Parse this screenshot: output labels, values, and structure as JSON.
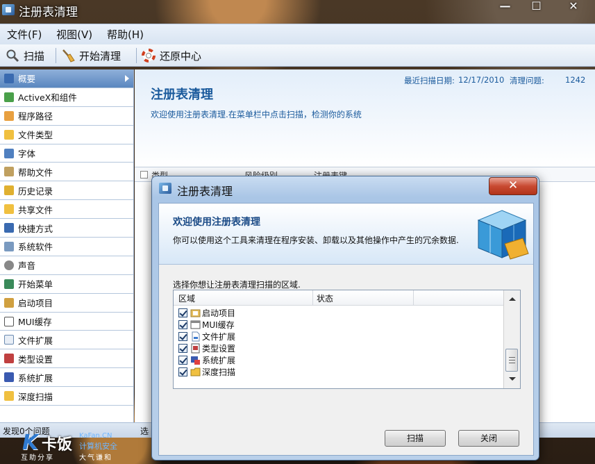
{
  "window": {
    "title": "注册表清理",
    "minimize": "—",
    "maximize": "☐",
    "close": "✕"
  },
  "menu": [
    "文件(F)",
    "视图(V)",
    "帮助(H)"
  ],
  "toolbar": {
    "scan": "扫描",
    "clean": "开始清理",
    "restore": "还原中心"
  },
  "sidebar": {
    "items": [
      "概要",
      "ActiveX和组件",
      "程序路径",
      "文件类型",
      "字体",
      "帮助文件",
      "历史记录",
      "共享文件",
      "快捷方式",
      "系统软件",
      "声音",
      "开始菜单",
      "启动项目",
      "MUI缓存",
      "文件扩展",
      "类型设置",
      "系统扩展",
      "深度扫描"
    ],
    "active_index": 0
  },
  "main": {
    "title": "注册表清理",
    "subtitle": "欢迎使用注册表清理.在菜单栏中点击扫描，检测你的系统",
    "last_scan_label": "最近扫描日期:",
    "last_scan_date": "12/17/2010",
    "issues_label": "清理问题:",
    "issues_count": "1242",
    "columns": [
      "类型",
      "风险级别",
      "注册表键"
    ]
  },
  "statusbar": {
    "left": "发现0个问题",
    "mid": "选"
  },
  "watermark": {
    "brand": "卡饭",
    "en": "KaFan.CN",
    "line1": "计算机安全",
    "line2": "互助分享",
    "line3": "大气谦和"
  },
  "dialog": {
    "title": "注册表清理",
    "close": "✕",
    "heading": "欢迎使用注册表清理",
    "description": "你可以使用这个工具来清理在程序安装、卸载以及其他操作中产生的冗余数据.",
    "prompt": "选择你想让注册表清理扫描的区域.",
    "columns": [
      "区域",
      "状态"
    ],
    "rows": [
      {
        "label": "启动项目",
        "checked": true
      },
      {
        "label": "MUI缓存",
        "checked": true
      },
      {
        "label": "文件扩展",
        "checked": true
      },
      {
        "label": "类型设置",
        "checked": true
      },
      {
        "label": "系统扩展",
        "checked": true
      },
      {
        "label": "深度扫描",
        "checked": true
      }
    ],
    "scan_button": "扫描",
    "close_button": "关闭"
  },
  "colors": {
    "accent": "#1a5a9c",
    "sidebar_active": "#5a87c0",
    "dialog_close": "#c84a32"
  }
}
